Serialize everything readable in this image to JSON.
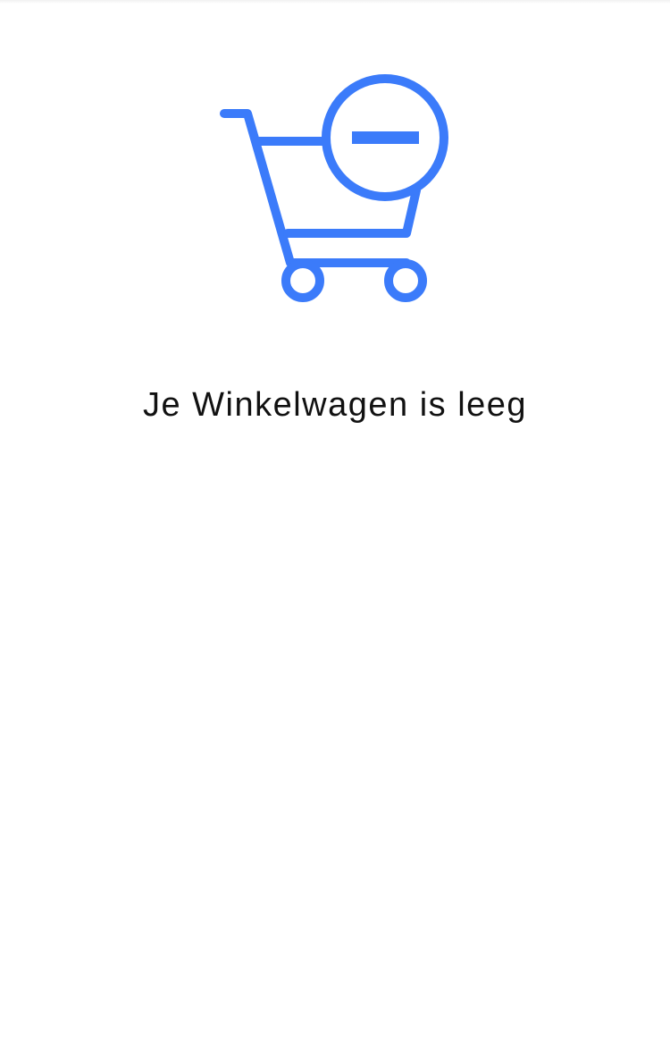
{
  "empty_state": {
    "icon": "cart-remove-icon",
    "message": "Je Winkelwagen is leeg"
  },
  "colors": {
    "accent": "#3b7bfa",
    "text": "#111111",
    "background": "#ffffff"
  }
}
